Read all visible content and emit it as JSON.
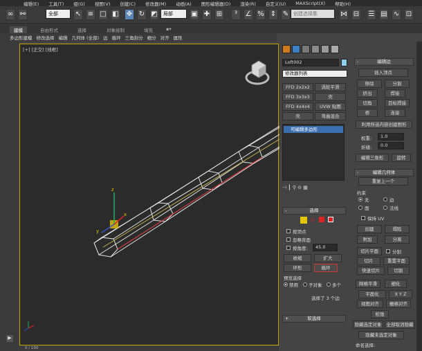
{
  "menubar": [
    "编辑(E)",
    "工具(T)",
    "组(G)",
    "视图(V)",
    "创建(C)",
    "修改器(M)",
    "动画(A)",
    "图形编辑器(D)",
    "渲染(R)",
    "自定义(U)",
    "MAXScript(X)",
    "帮助(H)"
  ],
  "toolbar": {
    "filter_select": "全部",
    "refcoord_select": "局部",
    "named_selection_placeholder": "创建选择集"
  },
  "ribbon": {
    "tabs": [
      "建模",
      "自由形式",
      "选择",
      "对象绘制",
      "填充"
    ],
    "active_tab": "建模",
    "subitems": [
      "多边形建模",
      "修改选择",
      "编辑",
      "几何体 (全部)",
      "边",
      "循环",
      "三角剖分",
      "细分",
      "对齐",
      "属性"
    ]
  },
  "viewport": {
    "label": "[+] [正交] [线框]"
  },
  "timeline": {
    "range": "0 / 100"
  },
  "command_panel": {
    "object_name": "Loft002",
    "modifier_list": "修改器列表",
    "mod_buttons": [
      [
        "FFD 2x2x2",
        "涡轮平滑"
      ],
      [
        "FFD 3x3x3",
        "壳"
      ],
      [
        "FFD 4x4x4",
        "UVW 贴图"
      ],
      [
        "壳",
        "弯曲混合"
      ]
    ],
    "stack_item": "可编辑多边形",
    "selection_rollout": "选择",
    "ignore_backfacing": "按顶点",
    "ignore_back": "忽略背面",
    "by_angle": "按角度:",
    "angle_value": "45.0",
    "shrink": "收缩",
    "grow": "扩大",
    "ring": "环形",
    "loop": "循环",
    "preview_selection": "预览选择",
    "preview_options": [
      "禁用",
      "子对象",
      "多个"
    ],
    "selected_info": "选择了 3 个边",
    "soft_selection": "软选择"
  },
  "right_panel": {
    "edit_edges_title": "编辑边",
    "insert_vertex": "插入顶点",
    "remove": "移除",
    "split": "分割",
    "extrude": "挤出",
    "weld": "焊接",
    "chamfer": "切角",
    "target_weld": "目标焊接",
    "bridge": "桥",
    "connect": "连接",
    "create_shape": "利用所选内容创建图形",
    "weight_label": "权重:",
    "weight_value": "1.0",
    "crease_label": "折缝:",
    "crease_value": "0.0",
    "edit_tri": "编辑三角形",
    "turn": "旋转",
    "edit_geometry_title": "编辑几何体",
    "repeat_last": "重复上一个",
    "constraints_label": "约束",
    "constraint_options": [
      "无",
      "边",
      "面",
      "法线"
    ],
    "preserve_uv": "保持 UV",
    "create": "创建",
    "collapse": "塌陷",
    "attach": "附加",
    "detach": "分离",
    "slice_plane": "切片平面",
    "split_chk": "分割",
    "slice": "切片",
    "reset_plane": "重置平面",
    "quickslice": "快速切片",
    "cut": "切割",
    "meshsmooth": "网格平滑",
    "tessellate": "细化",
    "planarize": "平面化",
    "view_align": "视图对齐",
    "grid_align": "栅格对齐",
    "relax": "松弛",
    "hide_selected": "隐藏选定对象",
    "unhide_all": "全部取消隐藏",
    "hide_unselected": "隐藏未选定对象",
    "named_selections": "命名选择:"
  }
}
